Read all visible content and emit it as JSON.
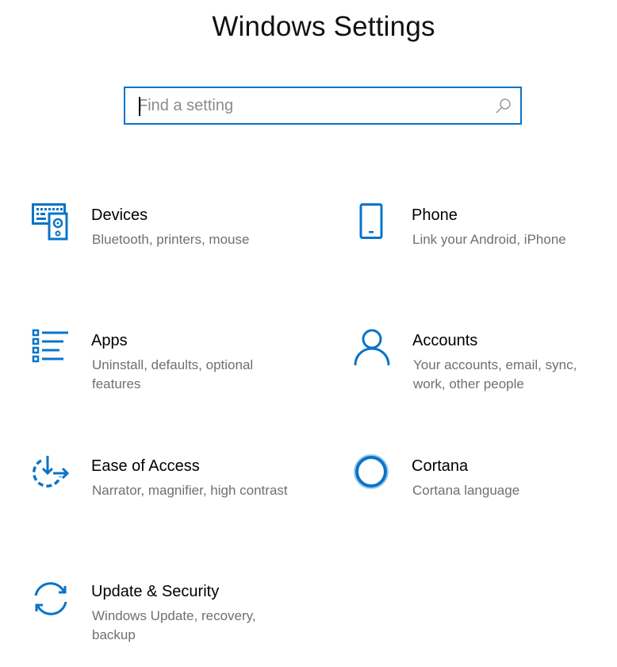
{
  "page": {
    "title": "Windows Settings"
  },
  "search": {
    "placeholder": "Find a setting",
    "value": "",
    "icon": "search-icon"
  },
  "accent_color": "#0a74c8",
  "tiles": [
    {
      "id": "devices",
      "name": "Devices",
      "description": "Bluetooth, printers, mouse",
      "icon": "devices-icon"
    },
    {
      "id": "phone",
      "name": "Phone",
      "description": "Link your Android, iPhone",
      "icon": "phone-icon"
    },
    {
      "id": "apps",
      "name": "Apps",
      "description": "Uninstall, defaults, optional features",
      "icon": "apps-icon"
    },
    {
      "id": "accounts",
      "name": "Accounts",
      "description": "Your accounts, email, sync, work, other people",
      "icon": "person-icon"
    },
    {
      "id": "ease-of-access",
      "name": "Ease of Access",
      "description": "Narrator, magnifier, high contrast",
      "icon": "ease-of-access-icon"
    },
    {
      "id": "cortana",
      "name": "Cortana",
      "description": "Cortana language",
      "icon": "cortana-icon"
    },
    {
      "id": "update-security",
      "name": "Update & Security",
      "description": "Windows Update, recovery, backup",
      "icon": "update-sync-icon"
    }
  ]
}
